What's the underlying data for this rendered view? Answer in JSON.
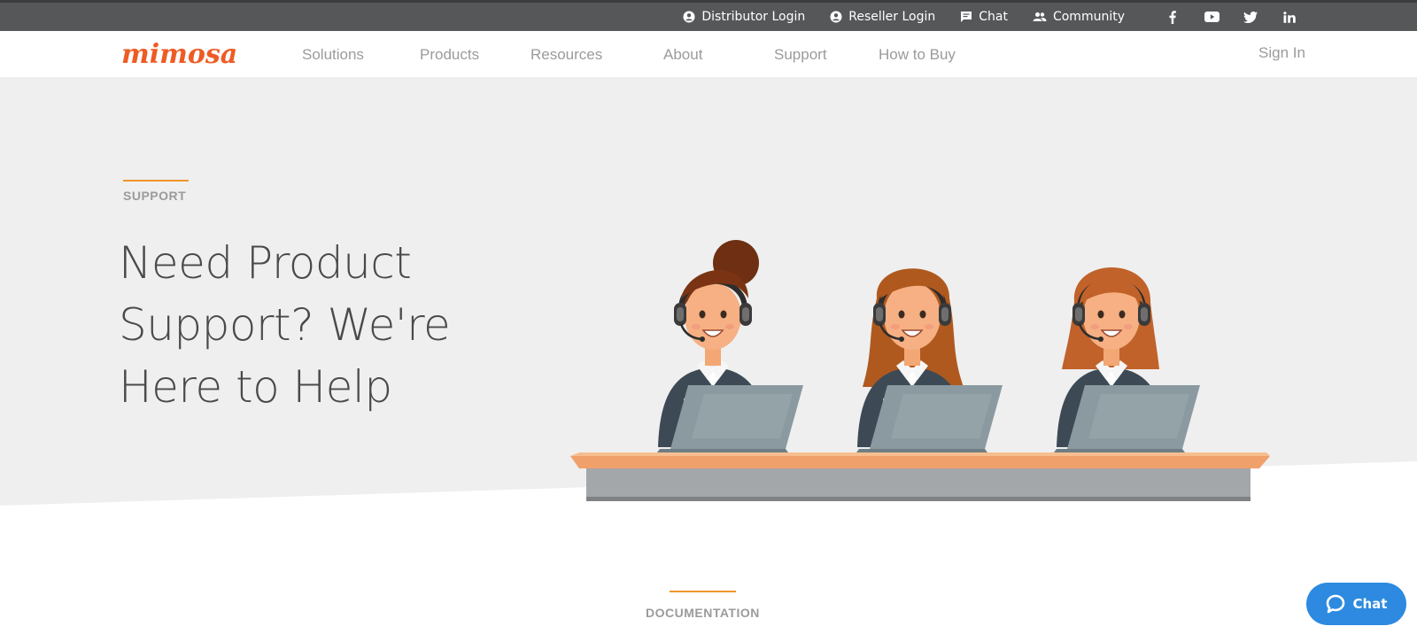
{
  "topbar": {
    "links": [
      {
        "label": "Distributor Login",
        "icon": "user-circle-icon"
      },
      {
        "label": "Reseller Login",
        "icon": "user-circle-icon"
      },
      {
        "label": "Chat",
        "icon": "chat-icon"
      },
      {
        "label": "Community",
        "icon": "people-icon"
      }
    ],
    "social": [
      "facebook-icon",
      "youtube-icon",
      "twitter-icon",
      "linkedin-icon"
    ]
  },
  "brand": {
    "logo_text": "mimosa",
    "color": "#ee5b24"
  },
  "nav": {
    "items": [
      "Solutions",
      "Products",
      "Resources",
      "About",
      "Support",
      "How to Buy"
    ],
    "sign_in": "Sign In"
  },
  "hero": {
    "eyebrow": "SUPPORT",
    "headline_lines": [
      "Need Product",
      "Support? We're",
      "Here to Help"
    ],
    "illustration": "support-agents-illustration"
  },
  "section": {
    "eyebrow": "DOCUMENTATION"
  },
  "chat_widget": {
    "label": "Chat",
    "color": "#2d8ae0"
  },
  "colors": {
    "accent": "#f0952b",
    "topbar": "#555759",
    "hero_bg": "#efefef"
  }
}
